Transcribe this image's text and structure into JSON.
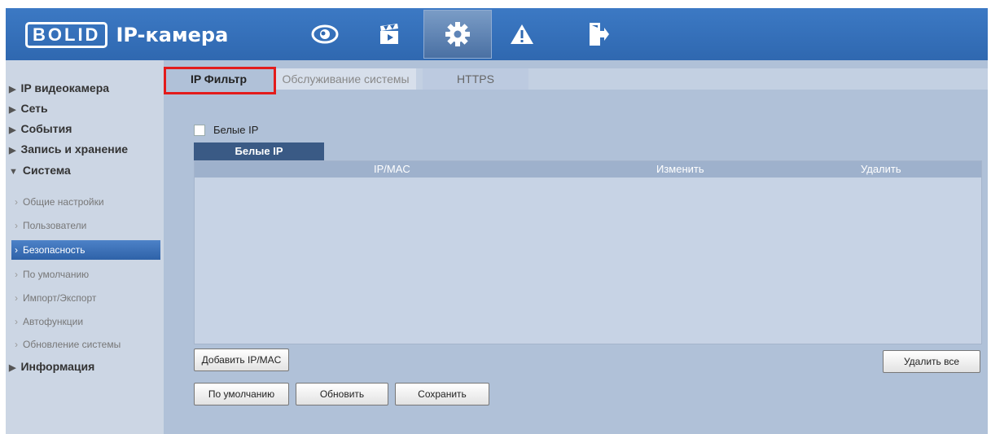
{
  "colors": {
    "header": "#2f68b0",
    "sidebar_bg": "#ccd6e4",
    "content_bg": "#b0c1d8",
    "active_item": "#2e62a8",
    "highlight": "#e31b1b"
  },
  "header": {
    "logo_box": "BOLID",
    "logo_text": "IP-камера",
    "nav_icons": [
      "eye-icon",
      "clapperboard-icon",
      "gear-icon",
      "warning-icon",
      "exit-icon"
    ],
    "active_nav": "gear-icon"
  },
  "sidebar": {
    "items": [
      {
        "label": "IP видеокамера",
        "expanded": false
      },
      {
        "label": "Сеть",
        "expanded": false
      },
      {
        "label": "События",
        "expanded": false
      },
      {
        "label": "Запись и хранение",
        "expanded": false
      },
      {
        "label": "Система",
        "expanded": true
      },
      {
        "label": "Информация",
        "expanded": false
      }
    ],
    "system_subitems": [
      "Общие настройки",
      "Пользователи",
      "Безопасность",
      "По умолчанию",
      "Импорт/Экспорт",
      "Автофункции",
      "Обновление системы"
    ],
    "active_subitem": "Безопасность"
  },
  "tabs": [
    "IP Фильтр",
    "Обслуживание системы",
    "HTTPS"
  ],
  "active_tab": "IP Фильтр",
  "filter": {
    "checkbox_label": "Белые IP",
    "checked": false,
    "list_tab": "Белые IP",
    "columns": [
      "IP/MAC",
      "Изменить",
      "Удалить"
    ],
    "rows": []
  },
  "buttons": {
    "add": "Добавить IP/MAC",
    "delete_all": "Удалить все",
    "default": "По умолчанию",
    "refresh": "Обновить",
    "save": "Сохранить"
  }
}
